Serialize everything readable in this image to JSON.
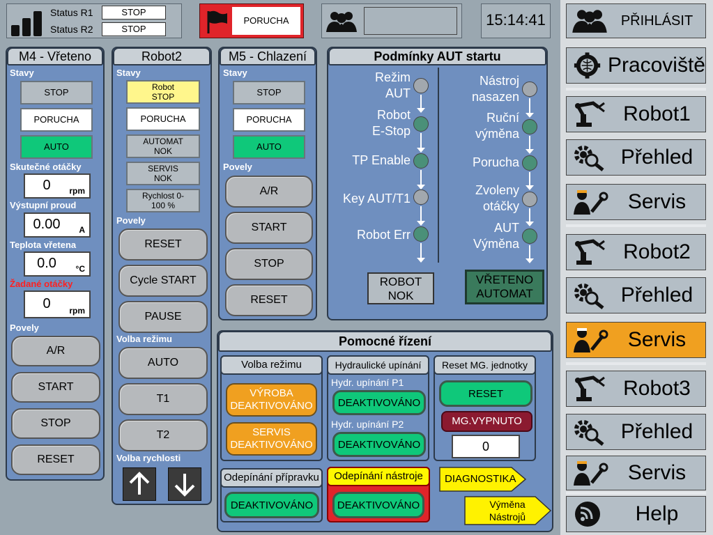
{
  "header": {
    "status_r1_label": "Status R1",
    "status_r1_value": "STOP",
    "status_r2_label": "Status R2",
    "status_r2_value": "STOP",
    "fault_label": "PORUCHA",
    "user_field": "",
    "clock": "15:14:41",
    "login_label": "PŘIHLÁSIT"
  },
  "m4": {
    "title": "M4 - Vřeteno",
    "stavy": "Stavy",
    "states": [
      "STOP",
      "PORUCHA",
      "AUTO"
    ],
    "speed_label": "Skutečné otáčky",
    "speed_value": "0",
    "speed_unit": "rpm",
    "current_label": "Výstupní proud",
    "current_value": "0.00",
    "current_unit": "A",
    "temp_label": "Teplota vřetena",
    "temp_value": "0.0",
    "temp_unit": "°C",
    "req_label": "Žadané otáčky",
    "req_value": "0",
    "req_unit": "rpm",
    "povely": "Povely",
    "commands": [
      "A/R",
      "START",
      "STOP",
      "RESET"
    ]
  },
  "robot2": {
    "title": "Robot2",
    "stavy": "Stavy",
    "states": [
      "Robot STOP",
      "PORUCHA",
      "AUTOMAT NOK",
      "SERVIS NOK",
      "Rychlost 0-100 %"
    ],
    "povely": "Povely",
    "commands": [
      "RESET",
      "Cycle START",
      "PAUSE"
    ],
    "mode_label": "Volba režimu",
    "modes": [
      "AUTO",
      "T1",
      "T2"
    ],
    "speed_label": "Volba rychlosti"
  },
  "m5": {
    "title": "M5 - Chlazení",
    "stavy": "Stavy",
    "states": [
      "STOP",
      "PORUCHA",
      "AUTO"
    ],
    "povely": "Povely",
    "commands": [
      "A/R",
      "START",
      "STOP",
      "RESET"
    ]
  },
  "aut": {
    "title": "Podmínky AUT startu",
    "left": [
      "Režim AUT",
      "Robot E-Stop",
      "TP Enable",
      "Key AUT/T1",
      "Robot Err"
    ],
    "right": [
      "Nástroj nasazen",
      "Ruční výměna",
      "Porucha",
      "Zvoleny otáčky",
      "AUT Výměna"
    ],
    "robot_nok": "ROBOT NOK",
    "spindle_auto": "VŘETENO AUTOMAT"
  },
  "aux": {
    "title": "Pomocné řízení",
    "mode_group": "Volba režimu",
    "vyroba": "VÝROBA DEAKTIVOVÁNO",
    "servis": "SERVIS DEAKTIVOVÁNO",
    "hyd_group": "Hydraulické upínání",
    "hyd_p1": "Hydr. upínání P1",
    "hyd_p1_btn": "DEAKTIVOVÁNO",
    "hyd_p2": "Hydr. upínání P2",
    "hyd_p2_btn": "DEAKTIVOVÁNO",
    "reset_group": "Reset MG. jednotky",
    "reset_btn": "RESET",
    "mg_off": "MG.VYPNUTO",
    "mg_value": "0",
    "fixture_group": "Odepínání přípravku",
    "fixture_btn": "DEAKTIVOVÁNO",
    "tool_group": "Odepínání nástroje",
    "tool_btn": "DEAKTIVOVÁNO",
    "diag": "DIAGNOSTIKA",
    "tool_change": "Výměna Nástrojů"
  },
  "nav": {
    "pracoviste": "Pracoviště",
    "robot1": "Robot1",
    "prehled1": "Přehled",
    "servis1": "Servis",
    "robot2": "Robot2",
    "prehled2": "Přehled",
    "servis2": "Servis",
    "robot3": "Robot3",
    "prehled3": "Přehled",
    "servis3": "Servis",
    "help": "Help"
  },
  "colors": {
    "panel": "#6f8fbf",
    "green": "#0fc87a",
    "orange": "#f0a020",
    "active_nav": "#f0a020",
    "fault_red": "#e0242a"
  }
}
